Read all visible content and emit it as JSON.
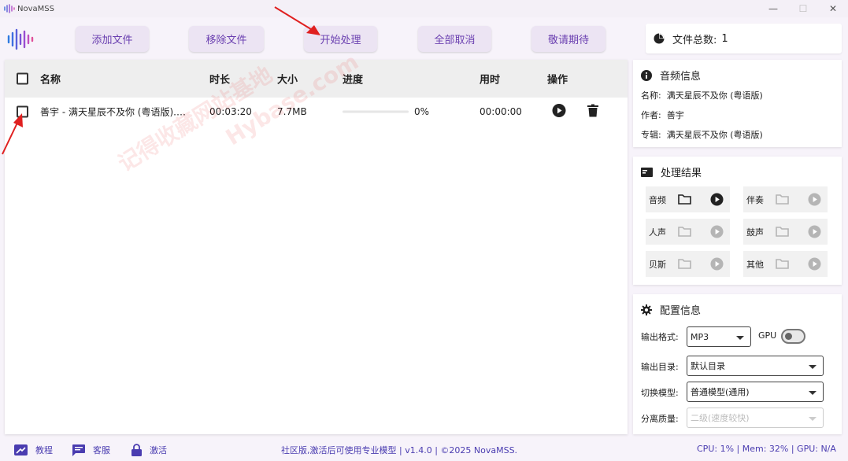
{
  "window": {
    "title": "NovaMSS",
    "minimize": "—",
    "maximize": "☐",
    "close": "✕"
  },
  "toolbar": {
    "add_files": "添加文件",
    "remove_files": "移除文件",
    "start_processing": "开始处理",
    "cancel_all": "全部取消",
    "coming_soon": "敬请期待"
  },
  "file_count": {
    "label": "文件总数:",
    "value": "1"
  },
  "table": {
    "headers": {
      "name": "名称",
      "duration": "时长",
      "size": "大小",
      "progress": "进度",
      "elapsed": "用时",
      "actions": "操作"
    },
    "rows": [
      {
        "name": "善宇 - 满天星辰不及你 (粤语版).…",
        "duration": "00:03:20",
        "size": "7.7MB",
        "progress": "0%",
        "progress_value": 0,
        "elapsed": "00:00:00"
      }
    ]
  },
  "audio_info": {
    "title": "音频信息",
    "name_label": "名称:",
    "name_value": "满天星辰不及你 (粤语版)",
    "author_label": "作者:",
    "author_value": "善宇",
    "album_label": "专辑:",
    "album_value": "满天星辰不及你 (粤语版)"
  },
  "results": {
    "title": "处理结果",
    "items": [
      {
        "label": "音频",
        "enabled": true
      },
      {
        "label": "伴奏",
        "enabled": false
      },
      {
        "label": "人声",
        "enabled": false
      },
      {
        "label": "鼓声",
        "enabled": false
      },
      {
        "label": "贝斯",
        "enabled": false
      },
      {
        "label": "其他",
        "enabled": false
      }
    ]
  },
  "config": {
    "title": "配置信息",
    "format_label": "输出格式:",
    "format_value": "MP3",
    "gpu_label": "GPU",
    "gpu_enabled": false,
    "dir_label": "输出目录:",
    "dir_value": "默认目录",
    "model_label": "切换模型:",
    "model_value": "普通模型(通用)",
    "quality_label": "分离质量:",
    "quality_value": "二级(速度较快)"
  },
  "footer": {
    "tutorial": "教程",
    "support": "客服",
    "activate": "激活",
    "center_text": "社区版,激活后可使用专业模型 | v1.4.0 | ©2025 NovaMSS.",
    "status": "CPU: 1% | Mem: 32% | GPU: N/A"
  },
  "watermark": {
    "line1": "记得收藏网站基地",
    "line2": "Hybase.com"
  },
  "colors": {
    "accent": "#6a3fb0",
    "button_bg": "#ece4f3",
    "footer_text": "#4a3cb0",
    "annotation_red": "#e02020"
  }
}
